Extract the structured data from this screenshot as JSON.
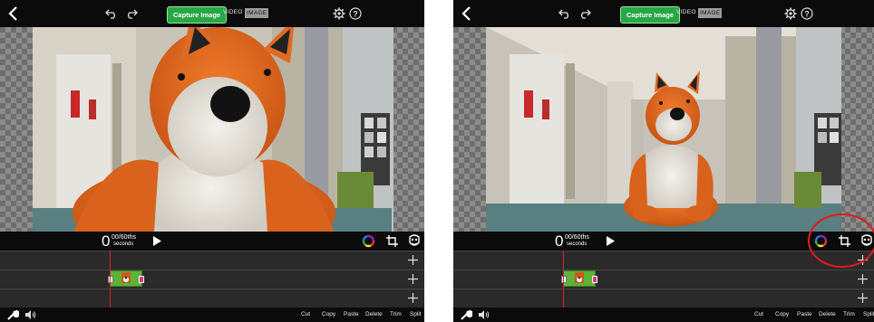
{
  "toolbar": {
    "capture_label": "Capture Image",
    "mode_video": "VIDEO",
    "mode_image": "IMAGE",
    "icons": [
      "back-icon",
      "undo-icon",
      "redo-icon",
      "gear-icon",
      "help-icon"
    ]
  },
  "transport": {
    "timecode_main": "0",
    "timecode_fraction": "00/60ths",
    "timecode_unit": "seconds",
    "icons": [
      "play-icon",
      "color-wheel-icon",
      "crop-icon",
      "mask-icon"
    ]
  },
  "timeline": {
    "track_add_icon": "plus-icon",
    "track_count": 3
  },
  "edit_actions": {
    "cut": "Cut",
    "copy": "Copy",
    "paste": "Paste",
    "delete": "Delete",
    "trim": "Trim",
    "split": "Split"
  },
  "colors": {
    "capture_button": "#28a745",
    "clip": "#5bb536",
    "playhead": "#d9252b",
    "highlight_ring": "#e11b1b",
    "background": "#0b0b0b"
  },
  "annotation": {
    "right_panel_highlight": "circle around color-wheel, crop, and mask icons"
  }
}
